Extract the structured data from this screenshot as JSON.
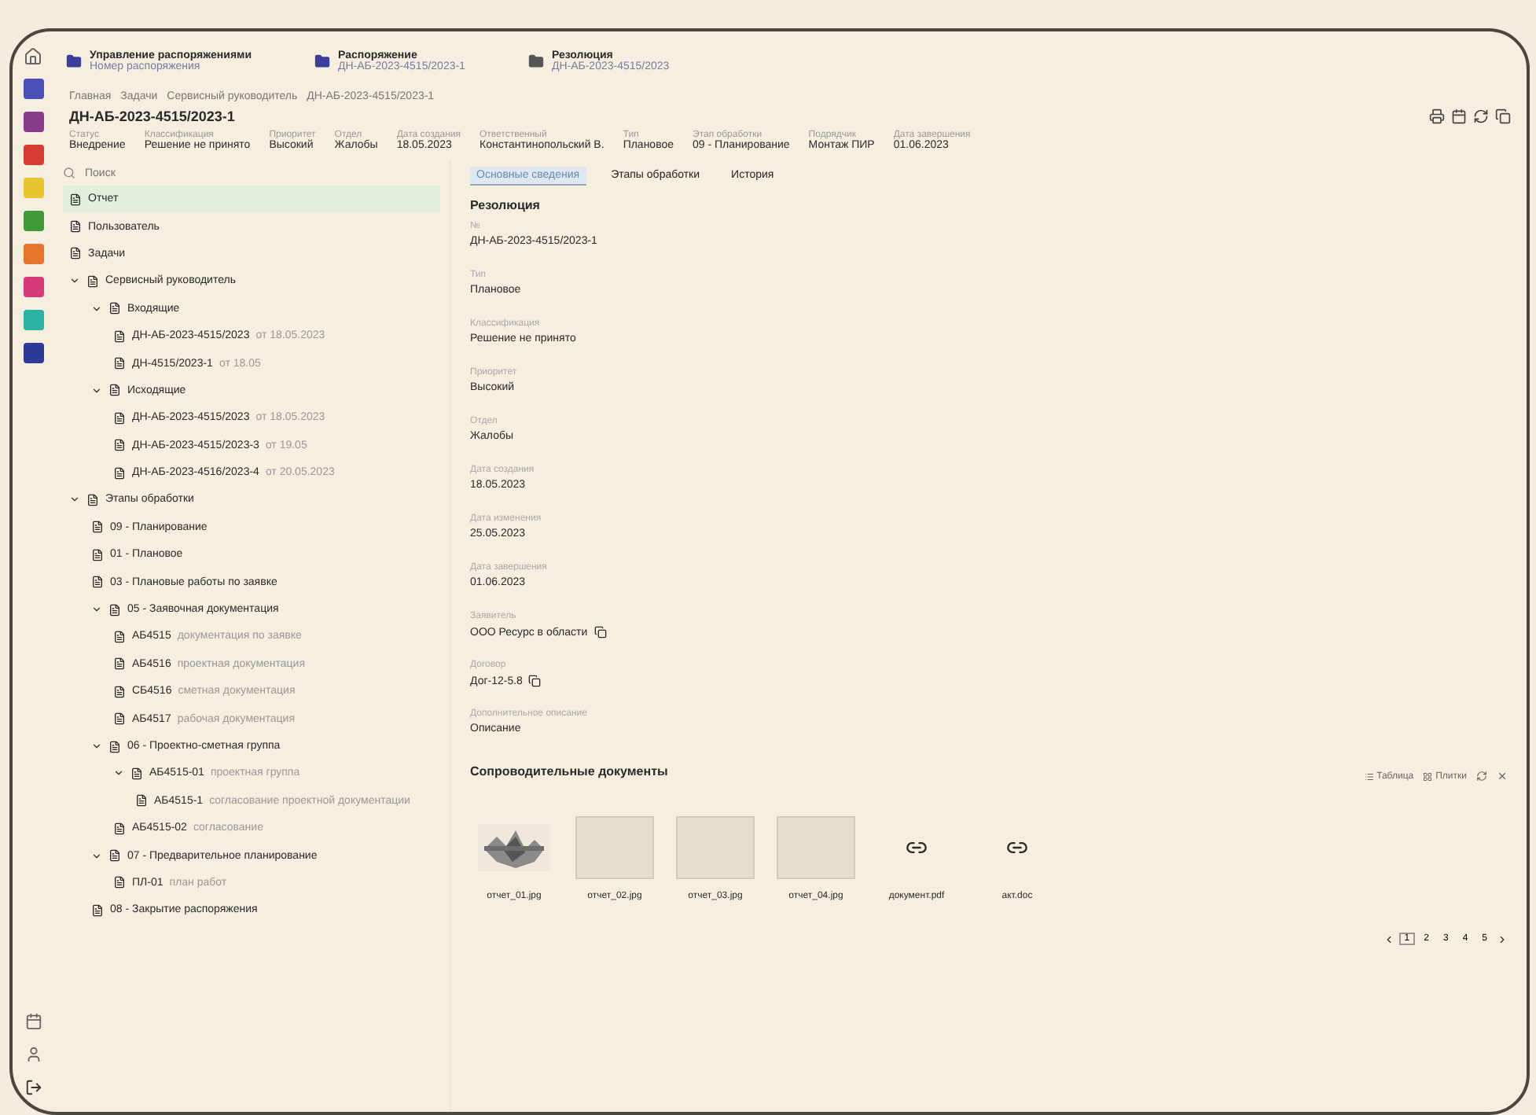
{
  "header": {
    "items": [
      {
        "title": "Управление распоряжениями",
        "subtitle": "Номер распоряжения",
        "color": "#3b3f9a"
      },
      {
        "title": "Распоряжение",
        "subtitle": "ДН-АБ-2023-4515/2023-1",
        "color": "#3b3f9a"
      },
      {
        "title": "Резолюция",
        "subtitle": "ДН-АБ-2023-4515/2023",
        "color": "#555555"
      }
    ]
  },
  "rail": [
    {
      "color": "#4a4fb8"
    },
    {
      "color": "#8a3c8c"
    },
    {
      "color": "#d63b2f"
    },
    {
      "color": "#e8c431"
    },
    {
      "color": "#3f9a3a"
    },
    {
      "color": "#e8762a"
    },
    {
      "color": "#d83a78"
    },
    {
      "color": "#2bb3a3"
    },
    {
      "color": "#2c3a9a"
    }
  ],
  "breadcrumbs": [
    "Главная",
    "Задачи",
    "Сервисный руководитель",
    "ДН-АБ-2023-4515/2023-1"
  ],
  "title": "ДН-АБ-2023-4515/2023-1",
  "meta": [
    {
      "label": "Статус",
      "value": "Внедрение"
    },
    {
      "label": "Классификация",
      "value": "Решение не принято"
    },
    {
      "label": "Приоритет",
      "value": "Высокий"
    },
    {
      "label": "Отдел",
      "value": "Жалобы"
    },
    {
      "label": "Дата создания",
      "value": "18.05.2023"
    },
    {
      "label": "Ответственный",
      "value": "Константинопольский В."
    },
    {
      "label": "Тип",
      "value": "Плановое"
    },
    {
      "label": "Этап обработки",
      "value": "09 - Планирование"
    },
    {
      "label": "Подрядчик",
      "value": "Монтаж ПИР"
    },
    {
      "label": "Дата завершения",
      "value": "01.06.2023"
    }
  ],
  "search": {
    "placeholder": "Поиск"
  },
  "tree": [
    {
      "label": "Отчет",
      "selected": true
    },
    {
      "label": "Пользователь",
      "selected": false
    },
    {
      "label": "Задачи",
      "selected": false
    },
    {
      "label": "Сервисный руководитель",
      "selected": false,
      "expanded": true,
      "children": [
        {
          "label": "Входящие",
          "selected": false,
          "expanded": true,
          "children": [
            {
              "label": "ДН-АБ-2023-4515/2023",
              "note": "от 18.05.2023",
              "selected": false
            },
            {
              "label": "ДН-4515/2023-1",
              "note": "от 18.05",
              "selected": false
            }
          ]
        },
        {
          "label": "Исходящие",
          "selected": false,
          "expanded": true,
          "children": [
            {
              "label": "ДН-АБ-2023-4515/2023",
              "note": "от 18.05.2023",
              "selected": false
            },
            {
              "label": "ДН-АБ-2023-4515/2023-3",
              "note": "от 19.05",
              "selected": false
            },
            {
              "label": "ДН-АБ-2023-4516/2023-4",
              "note": "от 20.05.2023",
              "selected": false
            }
          ]
        }
      ]
    },
    {
      "label": "Этапы обработки",
      "selected": false,
      "expanded": true,
      "children": [
        {
          "label": "09 - Планирование",
          "selected": false
        },
        {
          "label": "01 - Плановое",
          "selected": false
        },
        {
          "label": "03 - Плановые работы по заявке",
          "selected": false
        },
        {
          "label": "05 - Заявочная документация",
          "selected": false,
          "expanded": true,
          "children": [
            {
              "label": "АБ4515",
              "note": "документация по заявке",
              "selected": false
            },
            {
              "label": "АБ4516",
              "note": "проектная документация",
              "selected": false
            },
            {
              "label": "СБ4516",
              "note": "сметная документация",
              "selected": false
            },
            {
              "label": "АБ4517",
              "note": "рабочая документация",
              "selected": false
            }
          ]
        },
        {
          "label": "06 - Проектно-сметная группа",
          "selected": false,
          "expanded": true,
          "children": [
            {
              "label": "АБ4515-01",
              "note": "проектная группа",
              "selected": false,
              "expanded": true,
              "children": [
                {
                  "label": "АБ4515-1",
                  "note": "согласование проектной документации",
                  "selected": false
                }
              ]
            },
            {
              "label": "АБ4515-02",
              "note": "согласование",
              "selected": false
            }
          ]
        },
        {
          "label": "07 - Предварительное планирование",
          "selected": false,
          "expanded": true,
          "children": [
            {
              "label": "ПЛ-01",
              "note": "план работ",
              "selected": false
            }
          ]
        },
        {
          "label": "08 - Закрытие распоряжения",
          "selected": false
        }
      ]
    }
  ],
  "tabs": [
    {
      "label": "Основные сведения",
      "selected": true
    },
    {
      "label": "Этапы обработки",
      "selected": false
    },
    {
      "label": "История",
      "selected": false
    }
  ],
  "section_title": "Резолюция",
  "fields": [
    {
      "label": "№",
      "value": "ДН-АБ-2023-4515/2023-1"
    },
    {
      "label": "Тип",
      "value": "Плановое"
    },
    {
      "label": "Классификация",
      "value": "Решение не принято"
    },
    {
      "label": "Приоритет",
      "value": "Высокий"
    },
    {
      "label": "Отдел",
      "value": "Жалобы"
    },
    {
      "label": "Дата создания",
      "value": "18.05.2023"
    },
    {
      "label": "Дата изменения",
      "value": "25.05.2023"
    },
    {
      "label": "Дата завершения",
      "value": "01.06.2023"
    },
    {
      "label": "Заявитель",
      "value": "ООО Ресурс в области",
      "copy": true
    },
    {
      "label": "Договор",
      "value": "Дог-12-5.8",
      "copy": true
    },
    {
      "label": "Дополнительное описание",
      "value": "Описание"
    }
  ],
  "documents": {
    "title": "Сопроводительные документы",
    "actions": [
      "Таблица",
      "Плитки"
    ],
    "files": [
      {
        "name": "отчет_01.jpg"
      },
      {
        "kind": "blank",
        "name": "отчет_02.jpg"
      },
      {
        "kind": "blank",
        "name": "отчет_03.jpg"
      },
      {
        "kind": "blank",
        "name": "отчет_04.jpg"
      },
      {
        "kind": "link",
        "name": "документ.pdf"
      },
      {
        "kind": "link",
        "name": "акт.doc"
      }
    ],
    "pages": [
      {
        "label": "1",
        "selected": true
      },
      {
        "label": "2",
        "selected": false
      },
      {
        "label": "3",
        "selected": false
      },
      {
        "label": "4",
        "selected": false
      },
      {
        "label": "5",
        "selected": false
      }
    ]
  }
}
